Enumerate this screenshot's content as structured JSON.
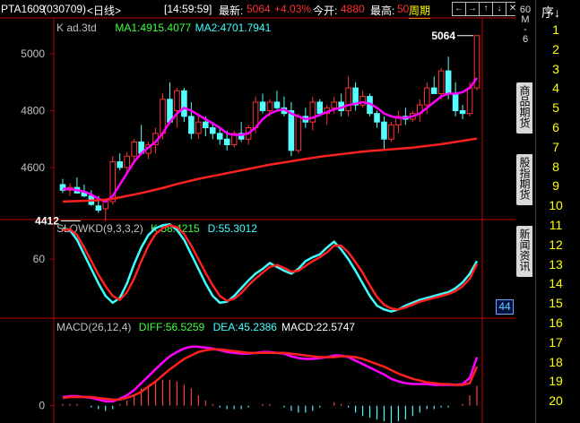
{
  "topbar": {
    "symbol": "PTA1609",
    "code": "(030709)",
    "period_label": "<日线>",
    "time": "[14:59:59]",
    "latest_label": "最新:",
    "latest_value": "5064",
    "change_pct": "+4.03%",
    "open_label": "今开:",
    "open_value": "4880",
    "high_label": "最高:",
    "high_value": "50",
    "cycle_label": "周期",
    "nav_buttons": [
      "←",
      "→",
      "↑",
      "↓",
      "✕"
    ]
  },
  "sidebar": {
    "header": [
      "60",
      "M",
      "-",
      "6"
    ],
    "tabs": [
      "商品期货",
      "股指期货",
      "新闻资讯"
    ]
  },
  "sequence": {
    "header": "序↓",
    "items": [
      "1",
      "2",
      "3",
      "4",
      "5",
      "6",
      "7",
      "8",
      "9",
      "10",
      "11",
      "12",
      "13",
      "14",
      "15",
      "16",
      "17",
      "18",
      "19",
      "20"
    ]
  },
  "badge": "44",
  "chart_data": [
    {
      "type": "candlestick",
      "title": "K  ad.3td",
      "indicators": [
        "MA1:4915.4077",
        "MA2:4701.7941"
      ],
      "ylim": [
        4420,
        5120
      ],
      "y_ticks": [
        "5000",
        "4800",
        "4600"
      ],
      "annotations": [
        {
          "text": "5064",
          "x": 58,
          "y": 5064
        },
        {
          "text": "4412",
          "x": 3,
          "y": 4412
        }
      ],
      "candles": [
        [
          4540,
          4560,
          4510,
          4520
        ],
        [
          4520,
          4545,
          4500,
          4530
        ],
        [
          4530,
          4565,
          4515,
          4510
        ],
        [
          4515,
          4540,
          4495,
          4500
        ],
        [
          4500,
          4520,
          4465,
          4470
        ],
        [
          4465,
          4500,
          4440,
          4450
        ],
        [
          4455,
          4490,
          4412,
          4480
        ],
        [
          4480,
          4640,
          4470,
          4620
        ],
        [
          4620,
          4650,
          4590,
          4600
        ],
        [
          4600,
          4655,
          4585,
          4640
        ],
        [
          4640,
          4700,
          4620,
          4690
        ],
        [
          4690,
          4750,
          4670,
          4650
        ],
        [
          4650,
          4690,
          4630,
          4680
        ],
        [
          4680,
          4740,
          4650,
          4720
        ],
        [
          4720,
          4860,
          4700,
          4840
        ],
        [
          4840,
          4900,
          4800,
          4760
        ],
        [
          4800,
          4880,
          4740,
          4870
        ],
        [
          4870,
          4880,
          4760,
          4780
        ],
        [
          4780,
          4830,
          4700,
          4720
        ],
        [
          4720,
          4790,
          4700,
          4760
        ],
        [
          4760,
          4780,
          4710,
          4740
        ],
        [
          4740,
          4760,
          4700,
          4720
        ],
        [
          4720,
          4740,
          4680,
          4700
        ],
        [
          4700,
          4730,
          4660,
          4680
        ],
        [
          4680,
          4730,
          4670,
          4720
        ],
        [
          4720,
          4760,
          4690,
          4700
        ],
        [
          4700,
          4750,
          4680,
          4740
        ],
        [
          4740,
          4850,
          4720,
          4830
        ],
        [
          4830,
          4860,
          4790,
          4800
        ],
        [
          4800,
          4840,
          4780,
          4830
        ],
        [
          4830,
          4870,
          4800,
          4810
        ],
        [
          4810,
          4850,
          4780,
          4790
        ],
        [
          4800,
          4830,
          4640,
          4660
        ],
        [
          4660,
          4790,
          4650,
          4780
        ],
        [
          4780,
          4810,
          4740,
          4760
        ],
        [
          4760,
          4850,
          4730,
          4830
        ],
        [
          4830,
          4840,
          4780,
          4790
        ],
        [
          4790,
          4820,
          4750,
          4810
        ],
        [
          4810,
          4850,
          4790,
          4830
        ],
        [
          4830,
          4860,
          4780,
          4800
        ],
        [
          4800,
          4920,
          4780,
          4880
        ],
        [
          4880,
          4900,
          4800,
          4820
        ],
        [
          4820,
          4870,
          4810,
          4850
        ],
        [
          4850,
          4860,
          4780,
          4790
        ],
        [
          4790,
          4800,
          4740,
          4760
        ],
        [
          4760,
          4780,
          4660,
          4700
        ],
        [
          4700,
          4760,
          4690,
          4750
        ],
        [
          4750,
          4800,
          4720,
          4780
        ],
        [
          4780,
          4810,
          4750,
          4770
        ],
        [
          4770,
          4800,
          4760,
          4790
        ],
        [
          4790,
          4840,
          4760,
          4820
        ],
        [
          4820,
          4900,
          4790,
          4880
        ],
        [
          4880,
          4920,
          4860,
          4860
        ],
        [
          4860,
          4950,
          4840,
          4940
        ],
        [
          4940,
          4990,
          4840,
          4860
        ],
        [
          4860,
          4900,
          4780,
          4800
        ],
        [
          4800,
          4820,
          4770,
          4790
        ],
        [
          4790,
          4900,
          4780,
          4880
        ],
        [
          4880,
          5064,
          4870,
          5064
        ]
      ],
      "series": [
        {
          "name": "MA1",
          "color": "#ff00ff",
          "values": [
            4525,
            4525,
            4520,
            4515,
            4505,
            4490,
            4480,
            4500,
            4540,
            4580,
            4620,
            4650,
            4670,
            4690,
            4720,
            4760,
            4790,
            4810,
            4800,
            4785,
            4770,
            4755,
            4740,
            4720,
            4715,
            4715,
            4720,
            4740,
            4770,
            4790,
            4800,
            4805,
            4790,
            4780,
            4770,
            4775,
            4785,
            4795,
            4805,
            4810,
            4820,
            4825,
            4830,
            4825,
            4810,
            4790,
            4780,
            4775,
            4775,
            4780,
            4790,
            4810,
            4830,
            4850,
            4860,
            4860,
            4865,
            4880,
            4915
          ]
        },
        {
          "name": "MA2",
          "color": "#ff2020",
          "values": [
            4480,
            4481,
            4482,
            4483,
            4484,
            4485,
            4487,
            4490,
            4495,
            4500,
            4505,
            4510,
            4516,
            4522,
            4528,
            4535,
            4542,
            4548,
            4554,
            4560,
            4565,
            4570,
            4575,
            4580,
            4585,
            4590,
            4595,
            4600,
            4605,
            4610,
            4614,
            4618,
            4622,
            4626,
            4630,
            4634,
            4638,
            4641,
            4644,
            4647,
            4650,
            4653,
            4656,
            4658,
            4660,
            4662,
            4664,
            4666,
            4668,
            4670,
            4673,
            4676,
            4679,
            4682,
            4686,
            4690,
            4694,
            4698,
            4702
          ]
        }
      ]
    },
    {
      "type": "line",
      "title": "SLOWKD(9,3,3,2)",
      "indicators": [
        "K:58.4215",
        "D:55.3012"
      ],
      "ylim": [
        0,
        100
      ],
      "y_ticks": [
        "60"
      ],
      "series": [
        {
          "name": "K",
          "color": "#40ffff",
          "values": [
            92,
            90,
            80,
            65,
            50,
            35,
            22,
            15,
            20,
            35,
            55,
            72,
            85,
            92,
            95,
            96,
            90,
            80,
            65,
            50,
            35,
            22,
            15,
            16,
            22,
            30,
            38,
            45,
            50,
            56,
            52,
            48,
            45,
            50,
            58,
            62,
            65,
            72,
            78,
            70,
            60,
            48,
            35,
            22,
            12,
            8,
            6,
            8,
            12,
            15,
            18,
            20,
            22,
            24,
            26,
            30,
            36,
            45,
            58
          ]
        },
        {
          "name": "D",
          "color": "#ff2020",
          "values": [
            90,
            91,
            85,
            72,
            58,
            44,
            32,
            22,
            18,
            26,
            40,
            58,
            74,
            86,
            92,
            95,
            93,
            86,
            74,
            60,
            46,
            33,
            22,
            17,
            19,
            25,
            33,
            40,
            46,
            52,
            54,
            51,
            47,
            48,
            53,
            58,
            62,
            67,
            74,
            74,
            67,
            57,
            46,
            33,
            21,
            13,
            9,
            8,
            10,
            13,
            16,
            18,
            20,
            22,
            24,
            27,
            32,
            40,
            55
          ]
        }
      ]
    },
    {
      "type": "bar+line",
      "title": "MACD(26,12,4)",
      "indicators": [
        "DIFF:56.5259",
        "DEA:45.2386",
        "MACD:22.5747"
      ],
      "ylim": [
        -20,
        100
      ],
      "y_ticks": [
        "0"
      ],
      "series": [
        {
          "name": "DIFF",
          "color": "#ff00ff",
          "values": [
            10,
            11,
            11,
            10,
            9,
            7,
            5,
            5,
            8,
            12,
            18,
            26,
            34,
            42,
            50,
            57,
            62,
            66,
            68,
            68,
            67,
            66,
            64,
            62,
            61,
            60,
            60,
            61,
            62,
            62,
            61,
            60,
            57,
            55,
            54,
            54,
            55,
            56,
            58,
            58,
            56,
            52,
            48,
            44,
            40,
            36,
            31,
            28,
            26,
            25,
            25,
            25,
            24,
            24,
            24,
            24,
            25,
            32,
            56
          ]
        },
        {
          "name": "DEA",
          "color": "#ff2020",
          "values": [
            9,
            10,
            10,
            10,
            10,
            9,
            8,
            7,
            7,
            9,
            12,
            16,
            22,
            28,
            35,
            42,
            48,
            54,
            58,
            62,
            64,
            65,
            65,
            64,
            63,
            62,
            61,
            61,
            61,
            61,
            61,
            61,
            60,
            59,
            58,
            57,
            56,
            56,
            56,
            57,
            57,
            56,
            54,
            51,
            48,
            45,
            41,
            37,
            34,
            31,
            29,
            27,
            26,
            25,
            25,
            24,
            24,
            26,
            45
          ]
        },
        {
          "name": "MACD",
          "color": "#ff4040",
          "values": [
            2,
            2,
            2,
            0,
            -2,
            -4,
            -6,
            -4,
            2,
            6,
            12,
            20,
            24,
            28,
            30,
            30,
            28,
            24,
            20,
            12,
            6,
            2,
            -2,
            -4,
            -4,
            -4,
            -2,
            0,
            2,
            2,
            0,
            -2,
            -6,
            -8,
            -8,
            -6,
            -2,
            0,
            4,
            2,
            -2,
            -8,
            -12,
            -14,
            -16,
            -18,
            -20,
            -18,
            -16,
            -12,
            -8,
            -4,
            -4,
            -2,
            -2,
            0,
            2,
            12,
            23
          ]
        }
      ]
    }
  ]
}
